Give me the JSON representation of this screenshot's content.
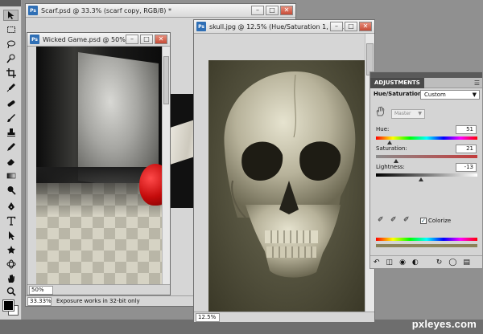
{
  "windows": {
    "scarf": {
      "title": "Scarf.psd @ 33.3% (scarf copy, RGB/8) *",
      "zoom": "33.33%",
      "status": "Exposure works in 32-bit only"
    },
    "wicked": {
      "title": "Wicked Game.psd @ 50%...",
      "zoom": "50%"
    },
    "skull": {
      "title": "skull.jpg @ 12.5% (Hue/Saturation 1, La...",
      "zoom": "12.5%"
    }
  },
  "adjustments": {
    "tab": "ADJUSTMENTS",
    "type": "Hue/Saturation",
    "preset": "Custom",
    "channel": "Master",
    "hue": {
      "label": "Hue:",
      "value": "51"
    },
    "saturation": {
      "label": "Saturation:",
      "value": "21"
    },
    "lightness": {
      "label": "Lightness:",
      "value": "-13"
    },
    "colorize_label": "Colorize",
    "colorize_checked": true
  },
  "watermark": "pxleyes.com",
  "colors": {
    "ps_badge": "#2f6fb5",
    "close_button": "#c64b36",
    "adj_tab": "#4a4a4a"
  }
}
